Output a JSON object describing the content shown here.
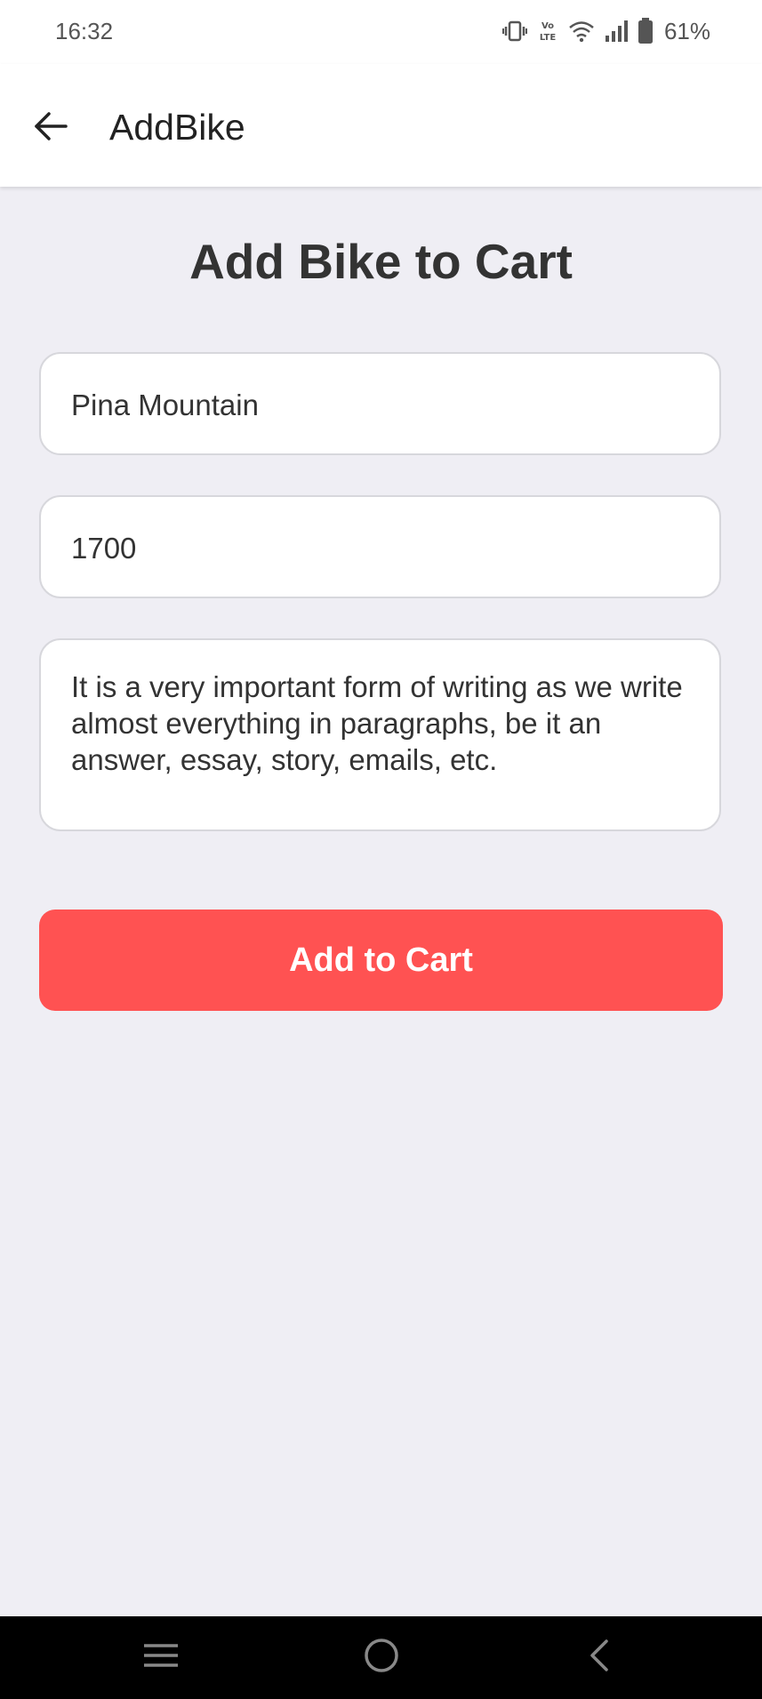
{
  "status_bar": {
    "time": "16:32",
    "battery": "61%",
    "icons": [
      "vibrate-icon",
      "volte-icon",
      "wifi-icon",
      "signal-icon",
      "battery-icon"
    ]
  },
  "app_bar": {
    "title": "AddBike",
    "back_icon": "arrow-left-icon"
  },
  "form": {
    "heading": "Add Bike to Cart",
    "name_value": "Pina Mountain",
    "price_value": "1700",
    "description_value": "It is a very important form of writing as we write almost everything in paragraphs, be it an answer, essay, story, emails, etc.",
    "submit_label": "Add to Cart"
  },
  "nav_bar": {
    "icons": [
      "menu-icon",
      "home-icon",
      "back-icon"
    ]
  },
  "colors": {
    "accent": "#ff5252",
    "background": "#efeef4",
    "surface": "#ffffff",
    "text": "#333333"
  }
}
